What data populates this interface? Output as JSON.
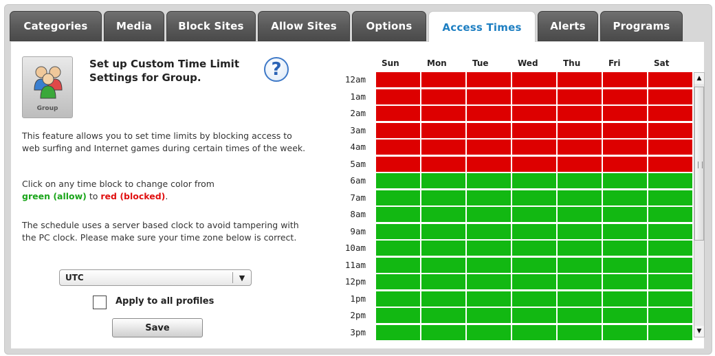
{
  "tabs": [
    {
      "label": "Categories",
      "width": 134,
      "active": false
    },
    {
      "label": "Media",
      "width": 88,
      "active": false
    },
    {
      "label": "Block Sites",
      "width": 130,
      "active": false
    },
    {
      "label": "Allow Sites",
      "width": 134,
      "active": false
    },
    {
      "label": "Options",
      "width": 108,
      "active": false
    },
    {
      "label": "Access Times",
      "width": 156,
      "active": true
    },
    {
      "label": "Alerts",
      "width": 88,
      "active": false
    },
    {
      "label": "Programs",
      "width": 120,
      "active": false
    }
  ],
  "group_icon": {
    "caption": "Group",
    "icon": "group-people-icon"
  },
  "title": "Set up Custom Time Limit Settings for Group.",
  "help_icon": "?",
  "description": "This feature allows you to set time limits by blocking access to web surfing and Internet games during certain times of the week.",
  "instruction": {
    "prefix": "Click on any time block to change color from",
    "green": "green (allow)",
    "middle": " to ",
    "red": "red (blocked)",
    "suffix": "."
  },
  "clock_note": "The schedule uses a server based clock to avoid tampering with the PC clock.  Please make sure your time zone below is correct.",
  "timezone": {
    "value": "UTC",
    "arrow": "▼"
  },
  "apply_all": {
    "label": "Apply to all profiles",
    "checked": false
  },
  "save_label": "Save",
  "days": [
    "Sun",
    "Mon",
    "Tue",
    "Wed",
    "Thu",
    "Fri",
    "Sat"
  ],
  "hours": [
    "12am",
    "1am",
    "2am",
    "3am",
    "4am",
    "5am",
    "6am",
    "7am",
    "8am",
    "9am",
    "10am",
    "11am",
    "12pm",
    "1pm",
    "2pm",
    "3pm"
  ],
  "schedule": {
    "blocked_hours": [
      "12am",
      "1am",
      "2am",
      "3am",
      "4am",
      "5am"
    ],
    "allowed_color": "#12b812",
    "blocked_color": "#dd0000"
  },
  "scrollbar": {
    "up": "▲",
    "down": "▼"
  }
}
